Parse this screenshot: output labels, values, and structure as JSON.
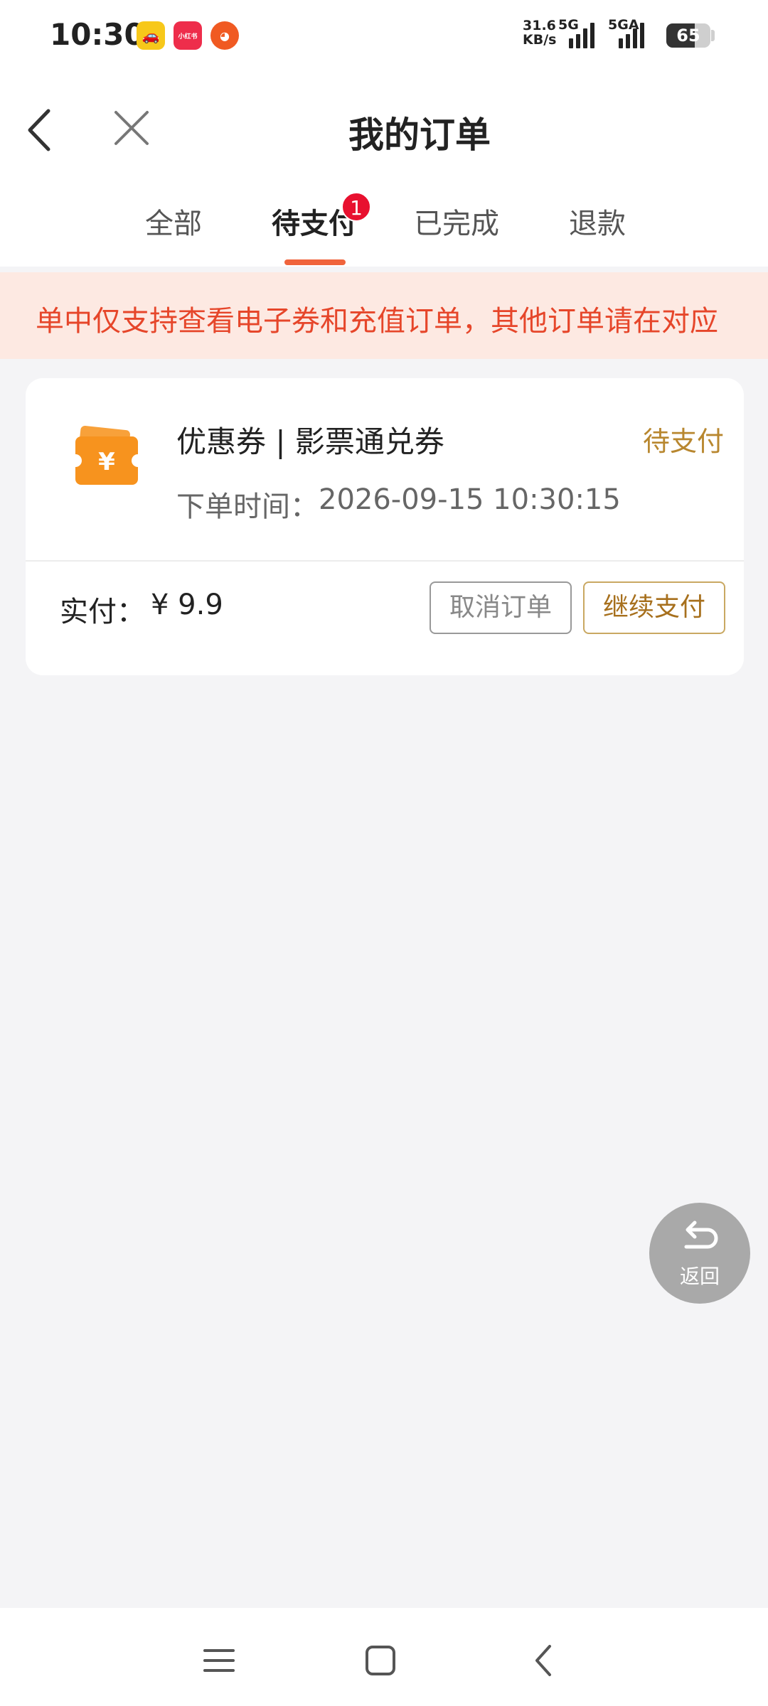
{
  "status_bar": {
    "time": "10:30",
    "app_icons": [
      {
        "name": "car-app-icon",
        "glyph": "🚗"
      },
      {
        "name": "xiaohongshu-icon",
        "glyph": "小红书"
      },
      {
        "name": "app-icon",
        "glyph": "◕"
      }
    ],
    "net_speed_value": "31.6",
    "net_speed_unit": "KB/s",
    "net_type_1": "5G",
    "net_type_2": "5GA",
    "battery": "65",
    "battery_level_percent": 65
  },
  "header": {
    "title": "我的订单",
    "back_icon": "chevron-left-icon",
    "close_icon": "close-icon"
  },
  "tabs": [
    {
      "label": "全部",
      "active": false
    },
    {
      "label": "待支付",
      "active": true,
      "badge": "1"
    },
    {
      "label": "已完成",
      "active": false
    },
    {
      "label": "退款",
      "active": false
    }
  ],
  "notice": {
    "text": "单中仅支持查看电子券和充值订单，其他订单请在对应",
    "color": "#e6462a"
  },
  "order": {
    "icon": "ticket-yuan-icon",
    "title": "优惠券 | 影票通兑券",
    "status": "待支付",
    "time_label": "下单时间：",
    "time_value": "2026-09-15 10:30:15",
    "pay_label": "实付：",
    "pay_amount": "¥  9.9",
    "cancel_button": "取消订单",
    "continue_button": "继续支付",
    "accent_color": "#b8872f"
  },
  "float_button": {
    "label": "返回",
    "icon": "return-arrow-icon"
  },
  "navbar": {
    "menu_icon": "menu-icon",
    "home_icon": "home-square-icon",
    "back_icon": "back-triangle-icon"
  },
  "colors": {
    "tab_underline": "#f0643c",
    "badge": "#e8102f",
    "page_bg": "#f4f4f6"
  }
}
